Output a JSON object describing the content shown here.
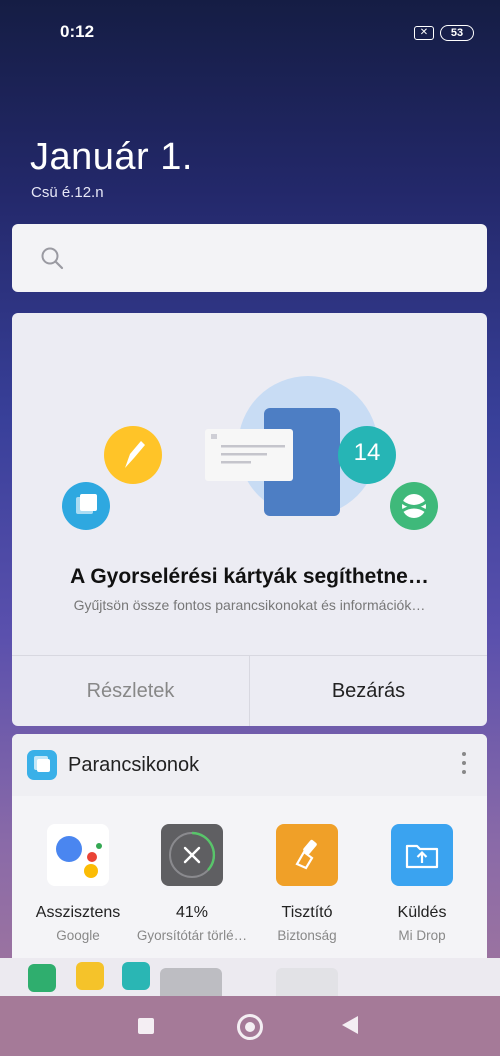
{
  "status": {
    "time": "0:12",
    "battery": "53",
    "sim_glyph": "✕"
  },
  "date": {
    "title": "Január 1.",
    "subtitle": "Csü é.12.n"
  },
  "card": {
    "badge_number": "14",
    "title": "A Gyorselérési kártyák segíthetne…",
    "subtitle": "Gyűjtsön össze fontos parancsikonokat és információk…",
    "details_label": "Részletek",
    "close_label": "Bezárás"
  },
  "shortcuts": {
    "header": "Parancsikonok",
    "apps": [
      {
        "name": "Asszisztens",
        "sub": "Google",
        "icon": "google-assistant-icon"
      },
      {
        "name": "41%",
        "sub": "Gyorsítótár törlé…",
        "icon": "cache-clear-icon"
      },
      {
        "name": "Tisztító",
        "sub": "Biztonság",
        "icon": "cleaner-brush-icon"
      },
      {
        "name": "Küldés",
        "sub": "Mi Drop",
        "icon": "mi-drop-upload-icon"
      }
    ]
  },
  "colors": {
    "assistant_bg": "#ffffff",
    "cache_bg": "#5f5f62",
    "cleaner_bg": "#f0a028",
    "midrop_bg": "#3aa3f0",
    "badge_teal": "#26b5b5",
    "pencil_yellow": "#ffc428",
    "card_blue": "#2ea8e0",
    "tennis_green": "#3fb97a"
  }
}
